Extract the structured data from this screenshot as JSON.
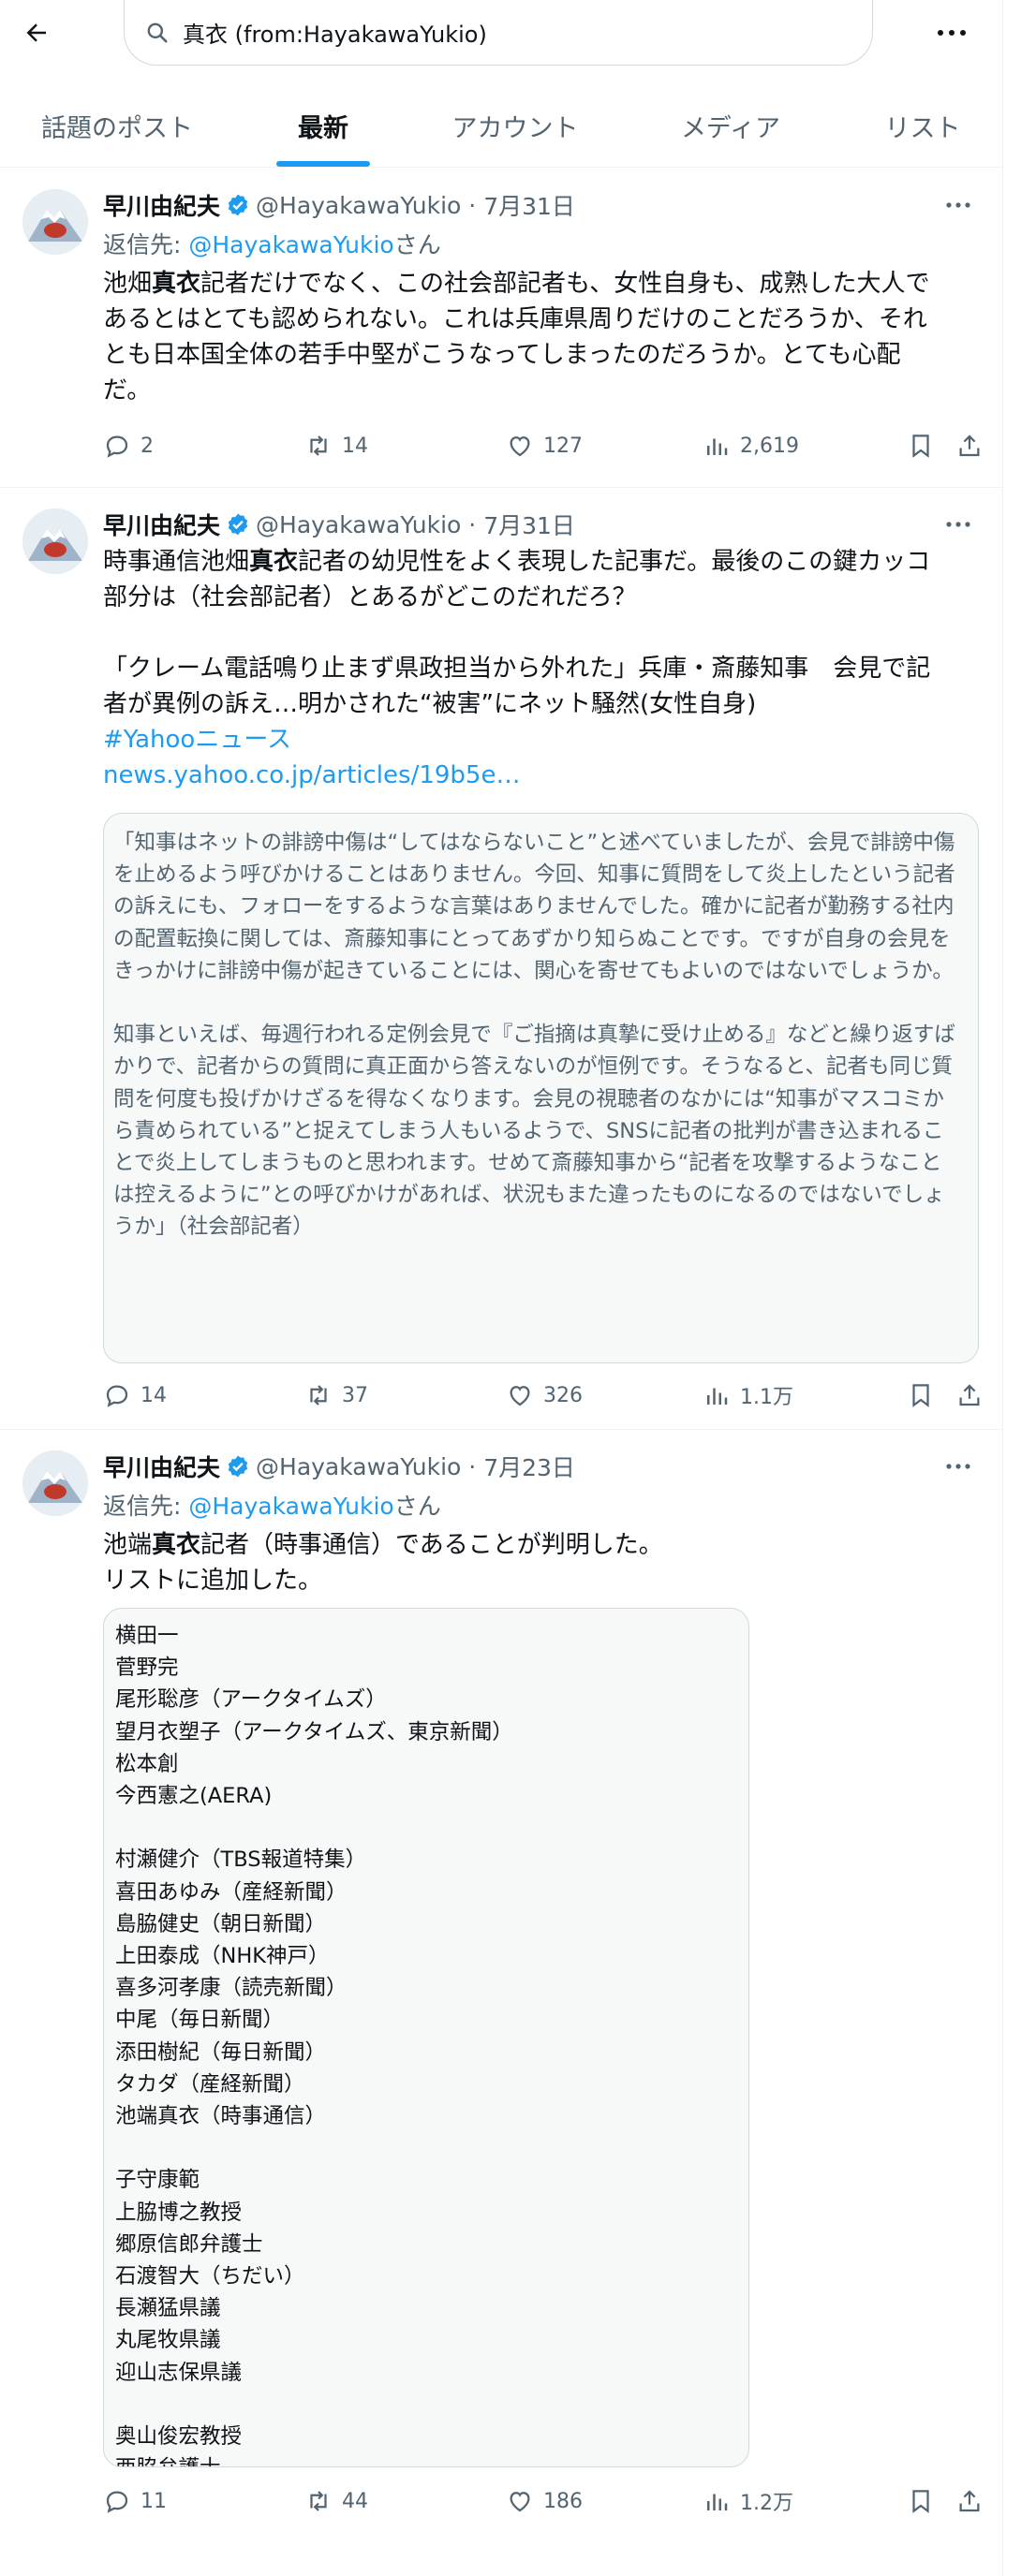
{
  "search": {
    "query": "真衣 (from:HayakawaYukio)"
  },
  "tabs": [
    {
      "label": "話題のポスト"
    },
    {
      "label": "最新"
    },
    {
      "label": "アカウント"
    },
    {
      "label": "メディア"
    },
    {
      "label": "リスト"
    }
  ],
  "colors": {
    "accent": "#1d9bf0",
    "muted": "#536471",
    "text": "#0f1419",
    "border": "#cfd9de"
  },
  "icons": [
    "back-arrow-icon",
    "search-icon",
    "more-icon",
    "verified-icon",
    "reply-icon",
    "retweet-icon",
    "like-icon",
    "views-icon",
    "bookmark-icon",
    "share-icon"
  ],
  "tweets": [
    {
      "name": "早川由紀夫",
      "handle": "@HayakawaYukio",
      "date": "7月31日",
      "reply_prefix": "返信先: ",
      "reply_to": "@HayakawaYukio",
      "reply_suffix": "さん",
      "text_1": "池畑",
      "text_bold": "真衣",
      "text_2": "記者だけでなく、この社会部記者も、女性自身も、成熟した大人で\nあるとはとても認められない。これは兵庫県周りだけのことだろうか、それ\nとも日本国全体の若手中堅がこうなってしまったのだろうか。とても心配\nだ。",
      "replies": "2",
      "retweets": "14",
      "likes": "127",
      "views": "2,619"
    },
    {
      "name": "早川由紀夫",
      "handle": "@HayakawaYukio",
      "date": "7月31日",
      "text_1": "時事通信池畑",
      "text_bold": "真衣",
      "text_2": "記者の幼児性をよく表現した記事だ。最後のこの鍵カッコ\n部分は（社会部記者）とあるがどこのだれだろ？\n\n「クレーム電話鳴り止まず県政担当から外れた」兵庫・斎藤知事　会見で記\n者が異例の訴え…明かされた“被害”にネット騒然(女性自身)",
      "hashtag": "#Yahooニュース",
      "link": "news.yahoo.co.jp/articles/19b5e…",
      "quote_text": "「知事はネットの誹謗中傷は“してはならないこと”と述べていましたが、会見で誹謗中傷\nを止めるよう呼びかけることはありません。今回、知事に質問をして炎上したという記者\nの訴えにも、フォローをするような言葉はありませんでした。確かに記者が勤務する社内\nの配置転換に関しては、斎藤知事にとってあずかり知らぬことです。ですが自身の会見を\nきっかけに誹謗中傷が起きていることには、関心を寄せてもよいのではないでしょうか。\n\n知事といえば、毎週行われる定例会見で『ご指摘は真摯に受け止める』などと繰り返すば\nかりで、記者からの質問に真正面から答えないのが恒例です。そうなると、記者も同じ質\n問を何度も投げかけざるを得なくなります。会見の視聴者のなかには“知事がマスコミか\nら責められている”と捉えてしまう人もいるようで、SNSに記者の批判が書き込まれるこ\nとで炎上してしまうものと思われます。せめて斎藤知事から“記者を攻撃するようなこと\nは控えるように”との呼びかけがあれば、状況もまた違ったものになるのではないでしょ\nうか」（社会部記者）",
      "replies": "14",
      "retweets": "37",
      "likes": "326",
      "views": "1.1万"
    },
    {
      "name": "早川由紀夫",
      "handle": "@HayakawaYukio",
      "date": "7月23日",
      "reply_prefix": "返信先: ",
      "reply_to": "@HayakawaYukio",
      "reply_suffix": "さん",
      "text_1": "池端",
      "text_bold": "真衣",
      "text_2": "記者（時事通信）であることが判明した。\nリストに追加した。",
      "list_text": "横田一\n菅野完\n尾形聡彦（アークタイムズ）\n望月衣塑子（アークタイムズ、東京新聞）\n松本創\n今西憲之(AERA)\n\n村瀬健介（TBS報道特集）\n喜田あゆみ（産経新聞）\n島脇健史（朝日新聞）\n上田泰成（NHK神戸）\n喜多河孝康（読売新聞）\n中尾（毎日新聞）\n添田樹紀（毎日新聞）\nタカダ（産経新聞）\n池端真衣（時事通信）\n\n子守康範\n上脇博之教授\n郷原信郎弁護士\n石渡智大（ちだい）\n長瀬猛県議\n丸尾牧県議\n迎山志保県議\n\n奥山俊宏教授\n西脇弁護士",
      "replies": "11",
      "retweets": "44",
      "likes": "186",
      "views": "1.2万"
    }
  ]
}
